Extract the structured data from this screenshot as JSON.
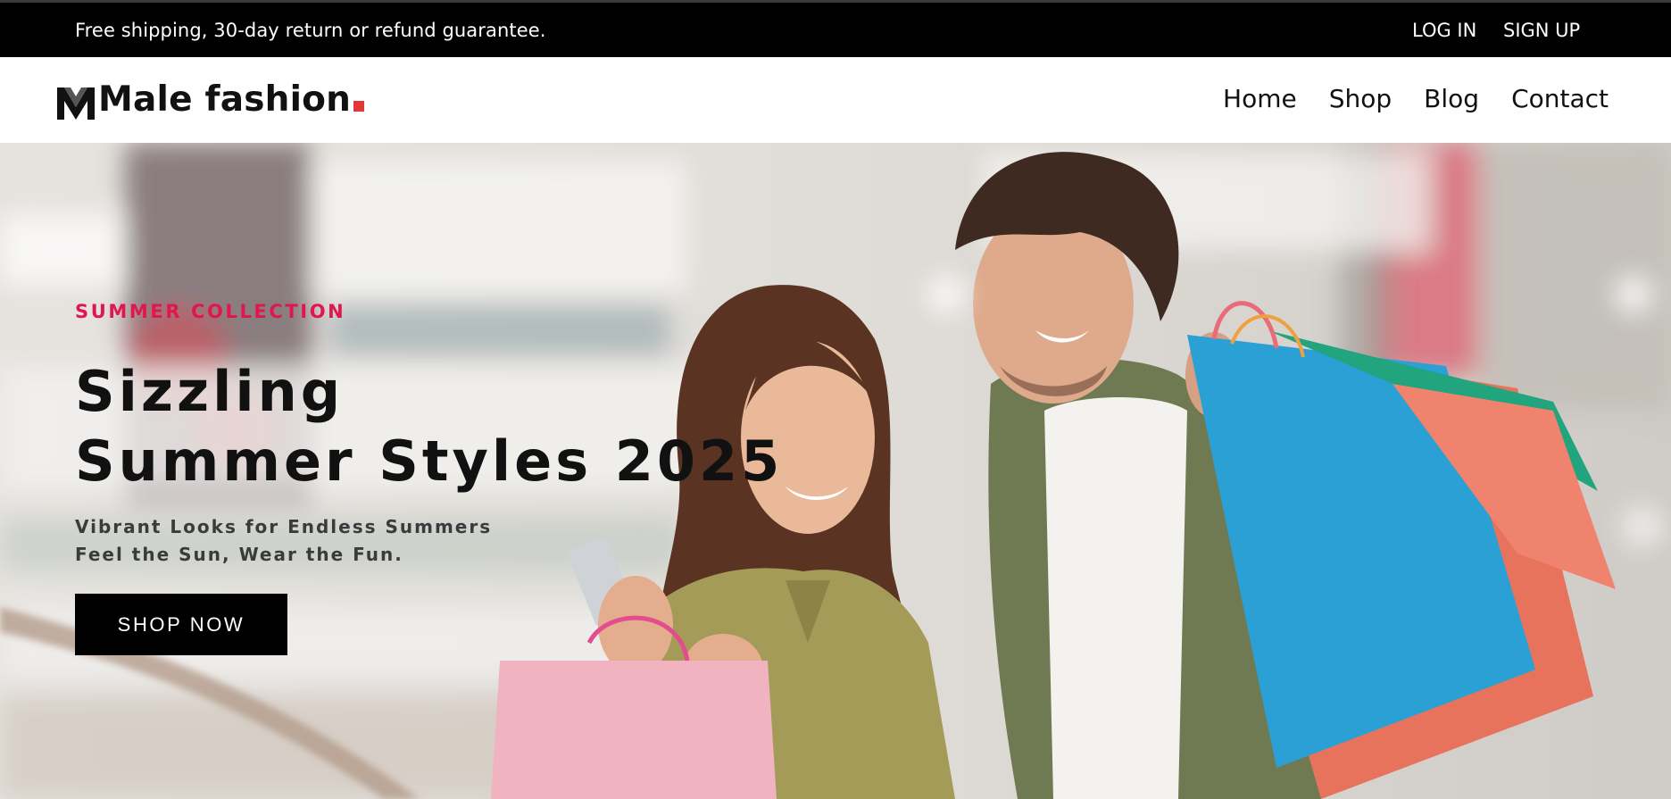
{
  "topbar": {
    "notice": "Free shipping, 30-day return or refund guarantee.",
    "login_label": "LOG IN",
    "signup_label": "SIGN UP"
  },
  "header": {
    "logo_text": "Male fashion",
    "logo_accent_color": "#e53637",
    "nav": [
      {
        "label": "Home"
      },
      {
        "label": "Shop"
      },
      {
        "label": "Blog"
      },
      {
        "label": "Contact"
      }
    ]
  },
  "hero": {
    "kicker": "SUMMER COLLECTION",
    "headline_line1": "Sizzling",
    "headline_line2": "Summer Styles 2025",
    "subtitle_line1": "Vibrant Looks for Endless Summers",
    "subtitle_line2": "Feel the Sun, Wear the Fun.",
    "cta_label": "SHOP NOW",
    "accent_color": "#e0174f",
    "image_description_icon": "couple-shopping-photo"
  }
}
